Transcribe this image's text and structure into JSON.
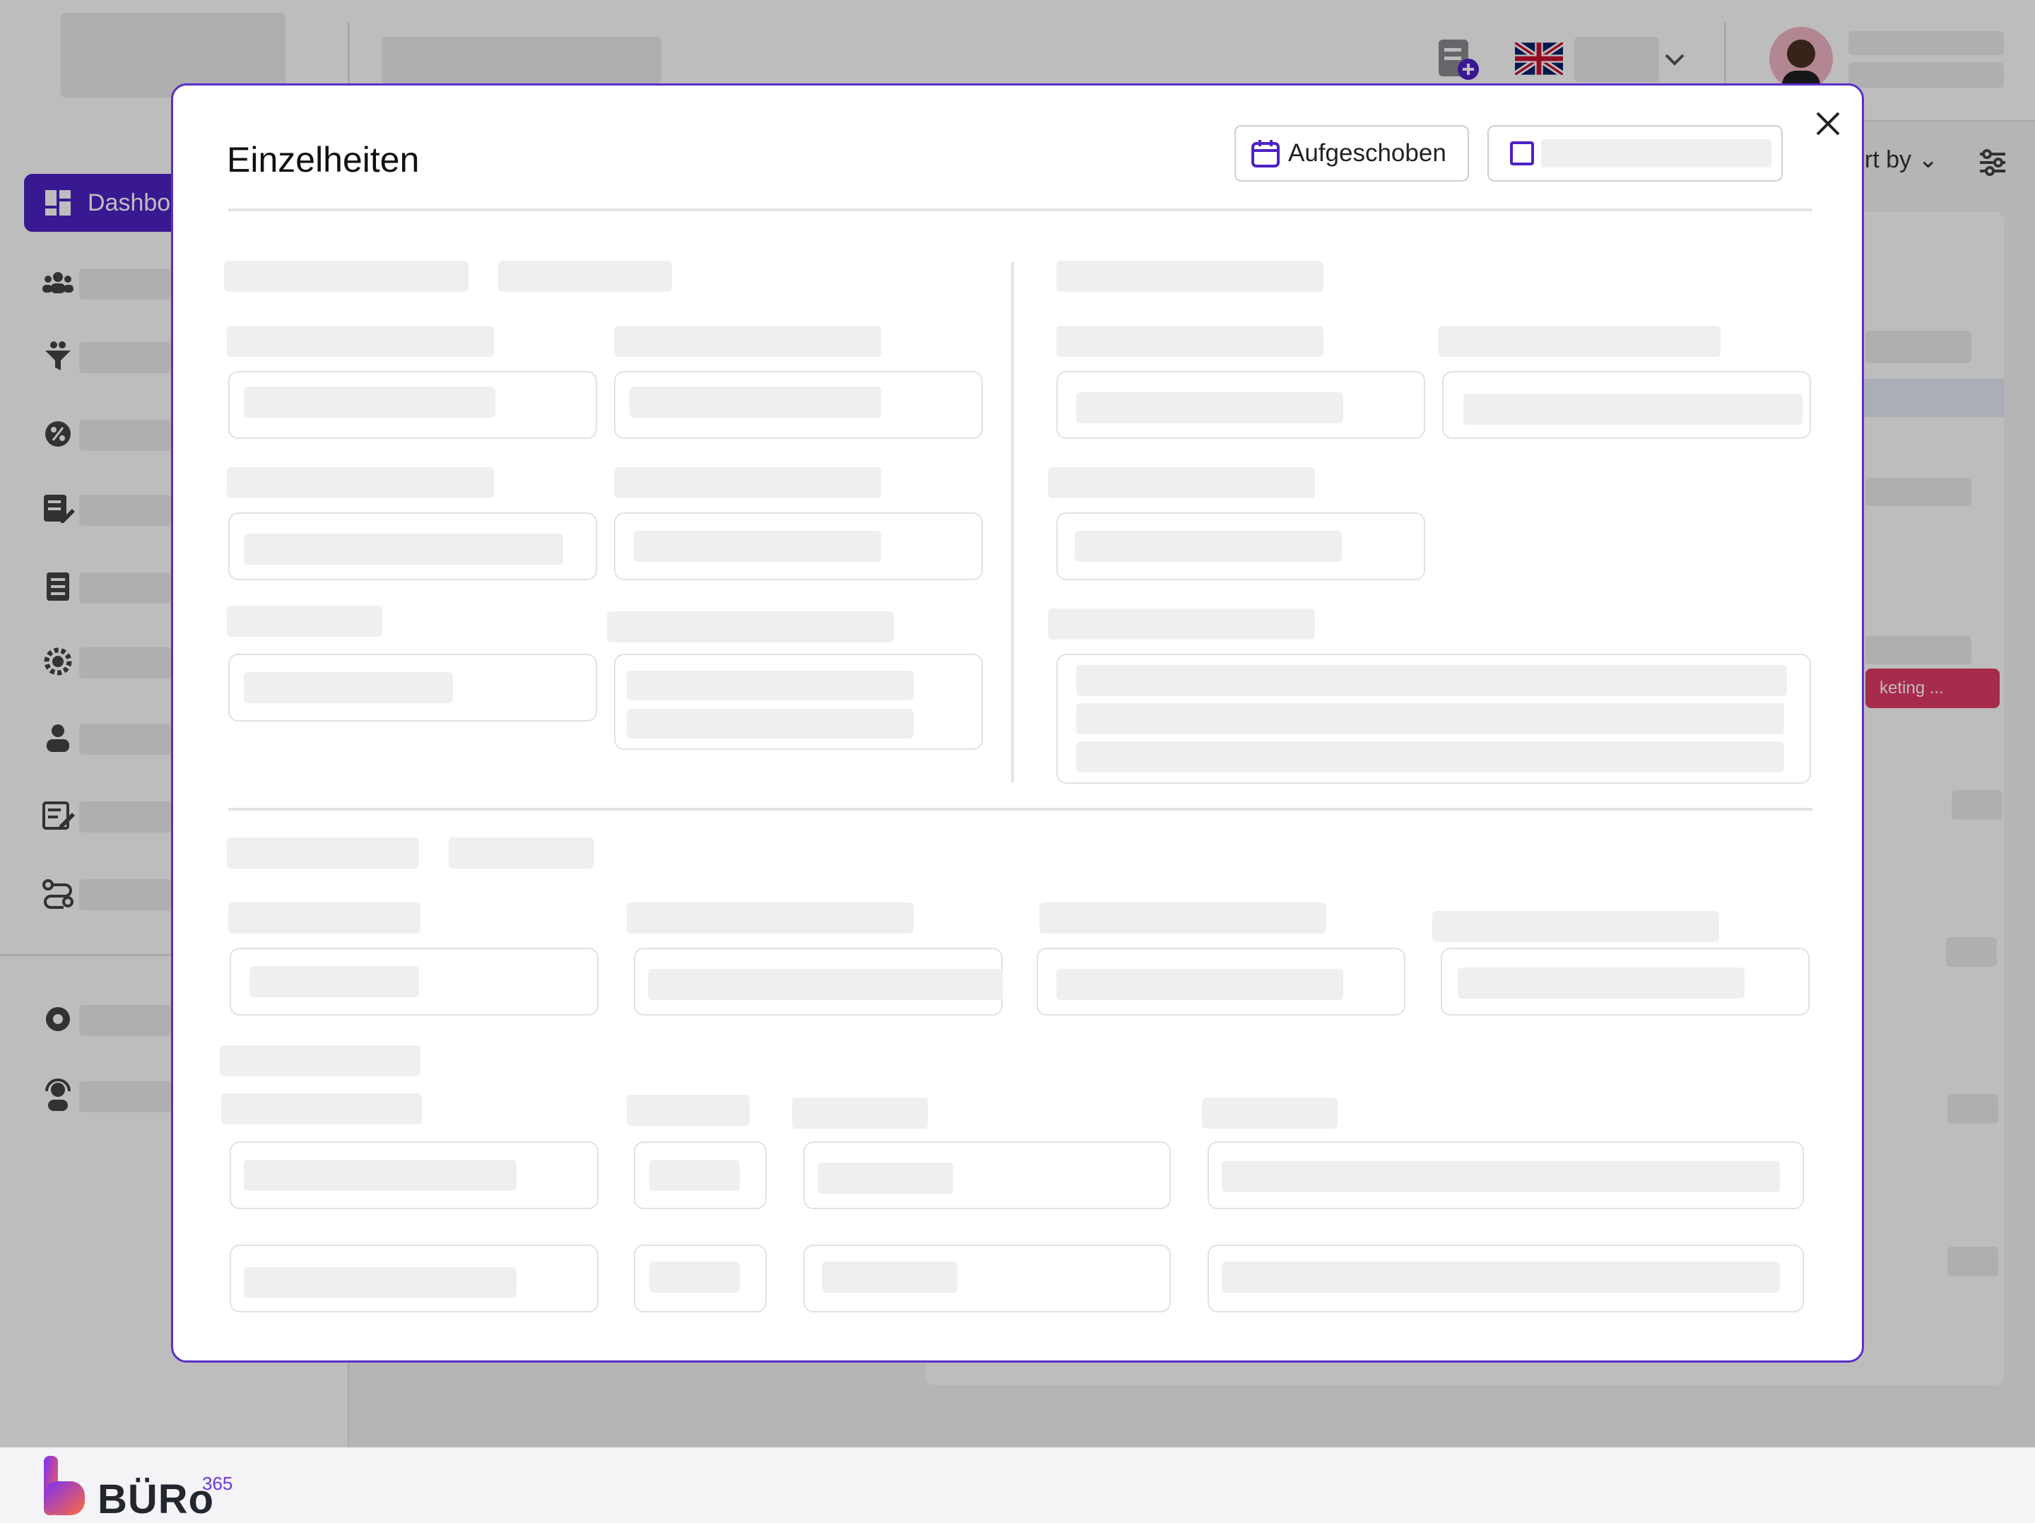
{
  "app": {
    "sidebar": {
      "active_item_label": "Dashbo",
      "items": [
        {
          "icon": "users-group-icon"
        },
        {
          "icon": "funnel-icon"
        },
        {
          "icon": "percent-gear-icon"
        },
        {
          "icon": "edit-document-icon"
        },
        {
          "icon": "list-document-icon"
        },
        {
          "icon": "settings-gear-icon"
        },
        {
          "icon": "person-icon"
        },
        {
          "icon": "notes-edit-icon"
        },
        {
          "icon": "route-icon"
        }
      ],
      "bottom_items": [
        {
          "icon": "cog-icon"
        },
        {
          "icon": "support-agent-icon"
        }
      ]
    },
    "header": {
      "language_flag": "uk-flag-icon"
    },
    "toolbar": {
      "sort_label": "ort by"
    },
    "table": {
      "tag_label": "keting ..."
    },
    "logo": {
      "text": "BÜRo",
      "superscript": "365"
    }
  },
  "modal": {
    "title": "Einzelheiten",
    "status_button_label": "Aufgeschoben",
    "close_icon": "close-icon"
  },
  "colors": {
    "accent": "#4e22c4",
    "modal_border": "#5b2ec9",
    "tag": "#e23a67",
    "logo_gradient_start": "#7b2ff7",
    "logo_gradient_end": "#ff6a3d"
  }
}
